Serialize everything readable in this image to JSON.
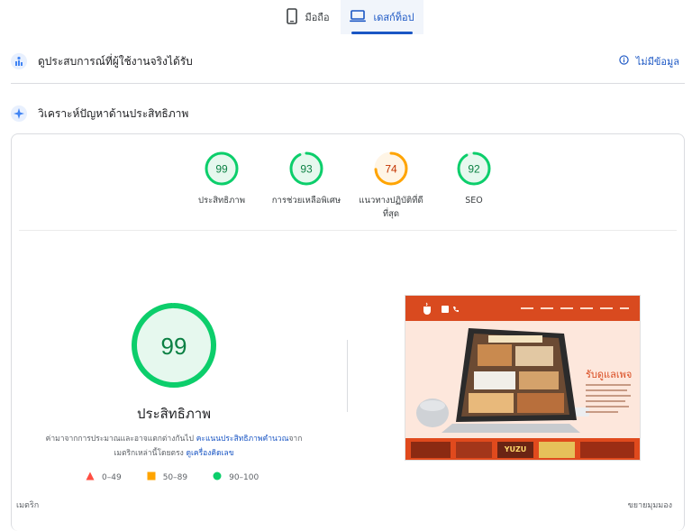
{
  "tabs": {
    "mobile": "มือถือ",
    "desktop": "เดสก์ท็อป"
  },
  "crux": {
    "title": "ดูประสบการณ์ที่ผู้ใช้งานจริงได้รับ",
    "no_data": "ไม่มีข้อมูล"
  },
  "diagnose": {
    "title": "วิเคราะห์ปัญหาด้านประสิทธิภาพ"
  },
  "gauges": [
    {
      "score": 99,
      "label_line1": "ประสิทธิภาพ",
      "label_line2": "",
      "color": "#0cce6b",
      "fill": "#e6f8ee",
      "text": "#0b8043"
    },
    {
      "score": 93,
      "label_line1": "การช่วยเหลือพิเศษ",
      "label_line2": "",
      "color": "#0cce6b",
      "fill": "#e6f8ee",
      "text": "#0b8043"
    },
    {
      "score": 74,
      "label_line1": "แนวทางปฏิบัติที่ดี",
      "label_line2": "ที่สุด",
      "color": "#ffa400",
      "fill": "#fff5e6",
      "text": "#c33300"
    },
    {
      "score": 92,
      "label_line1": "SEO",
      "label_line2": "",
      "color": "#0cce6b",
      "fill": "#e6f8ee",
      "text": "#0b8043"
    }
  ],
  "main": {
    "score": 99,
    "title": "ประสิทธิภาพ",
    "desc_prefix": "ค่ามาจากการประมาณและอาจแตกต่างกันไป ",
    "desc_link1": "คะแนนประสิทธิภาพคำนวณ",
    "desc_mid": "จากเมตริกเหล่านี้โดยตรง ",
    "desc_link2": "ดูเครื่องคิดเลข"
  },
  "legend": [
    {
      "range": "0–49",
      "shape": "triangle",
      "color": "#ff4e42"
    },
    {
      "range": "50–89",
      "shape": "square",
      "color": "#ffa400"
    },
    {
      "range": "90–100",
      "shape": "circle",
      "color": "#0cce6b"
    }
  ],
  "screenshot": {
    "heading": "รับดูแลเพจ",
    "strip_label": "YUZU"
  },
  "footer": {
    "left": "เมตริก",
    "right": "ขยายมุมมอง"
  },
  "colors": {
    "accent": "#1a56c4",
    "pass": "#0cce6b",
    "average": "#ffa400",
    "fail": "#ff4e42"
  }
}
